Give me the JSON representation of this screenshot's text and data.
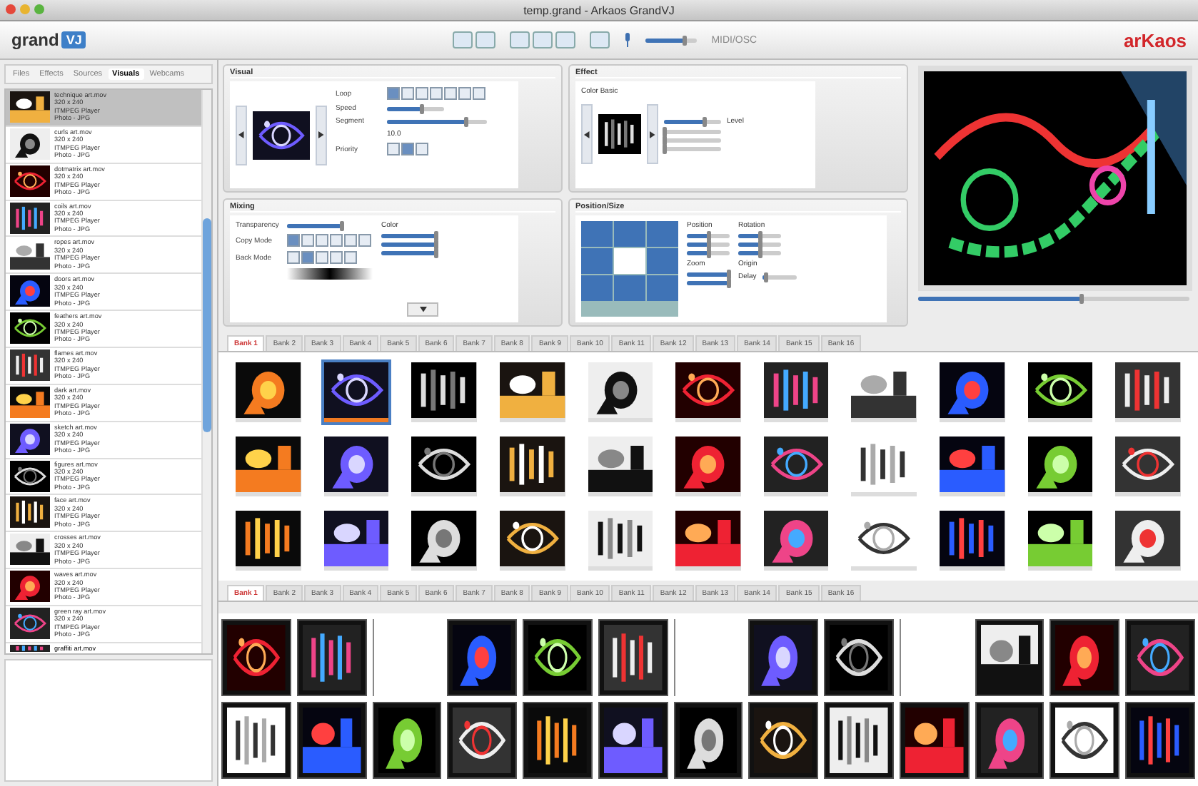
{
  "window": {
    "title": "temp.grand - Arkaos GrandVJ"
  },
  "toolbar": {
    "logo": "grand",
    "logo_badge": "VJ",
    "midi": "MIDI/OSC",
    "brand": "arKaos",
    "volume": {
      "level": 0.75
    }
  },
  "sidebar": {
    "tabs": [
      {
        "label": "Files",
        "selected": false
      },
      {
        "label": "Effects",
        "selected": false
      },
      {
        "label": "Sources",
        "selected": false
      },
      {
        "label": "Visuals",
        "selected": true
      },
      {
        "label": "Webcams",
        "selected": false
      }
    ],
    "items": [
      {
        "name": "technique art.mov",
        "size": "320 x 240",
        "player": "ITMPEG Player",
        "type": "Photo - JPG",
        "selected": true
      },
      {
        "name": "curls art.mov",
        "size": "320 x 240",
        "player": "ITMPEG Player",
        "type": "Photo - JPG",
        "selected": false
      },
      {
        "name": "dotmatrix art.mov",
        "size": "320 x 240",
        "player": "ITMPEG Player",
        "type": "Photo - JPG",
        "selected": false
      },
      {
        "name": "coils art.mov",
        "size": "320 x 240",
        "player": "ITMPEG Player",
        "type": "Photo - JPG",
        "selected": false
      },
      {
        "name": "ropes art.mov",
        "size": "320 x 240",
        "player": "ITMPEG Player",
        "type": "Photo - JPG",
        "selected": false
      },
      {
        "name": "doors art.mov",
        "size": "320 x 240",
        "player": "ITMPEG Player",
        "type": "Photo - JPG",
        "selected": false
      },
      {
        "name": "feathers art.mov",
        "size": "320 x 240",
        "player": "ITMPEG Player",
        "type": "Photo - JPG",
        "selected": false
      },
      {
        "name": "flames art.mov",
        "size": "320 x 240",
        "player": "ITMPEG Player",
        "type": "Photo - JPG",
        "selected": false
      },
      {
        "name": "dark art.mov",
        "size": "320 x 240",
        "player": "ITMPEG Player",
        "type": "Photo - JPG",
        "selected": false
      },
      {
        "name": "sketch art.mov",
        "size": "320 x 240",
        "player": "ITMPEG Player",
        "type": "Photo - JPG",
        "selected": false
      },
      {
        "name": "figures art.mov",
        "size": "320 x 240",
        "player": "ITMPEG Player",
        "type": "Photo - JPG",
        "selected": false
      },
      {
        "name": "face art.mov",
        "size": "320 x 240",
        "player": "ITMPEG Player",
        "type": "Photo - JPG",
        "selected": false
      },
      {
        "name": "crosses art.mov",
        "size": "320 x 240",
        "player": "ITMPEG Player",
        "type": "Photo - JPG",
        "selected": false
      },
      {
        "name": "waves art.mov",
        "size": "320 x 240",
        "player": "ITMPEG Player",
        "type": "Photo - JPG",
        "selected": false
      },
      {
        "name": "green ray art.mov",
        "size": "320 x 240",
        "player": "ITMPEG Player",
        "type": "Photo - JPG",
        "selected": false
      }
    ],
    "last_item": "graffiti art.mov"
  },
  "visual": {
    "title": "Visual",
    "loop_label": "Loop",
    "loop_modes": [
      {
        "selected": true
      },
      {
        "selected": false
      },
      {
        "selected": false
      },
      {
        "selected": false
      },
      {
        "selected": false
      },
      {
        "selected": false
      },
      {
        "selected": false
      }
    ],
    "speed_label": "Speed",
    "speed": {
      "level": 0.6
    },
    "segment_label": "Segment",
    "segment": {
      "level": 0.78
    },
    "segment_value": "10.0",
    "priority_label": "Priority",
    "priorities": [
      {
        "selected": false
      },
      {
        "selected": true
      },
      {
        "selected": false
      }
    ]
  },
  "effect": {
    "title": "Effect",
    "name": "Color Basic",
    "sliders": [
      {
        "level": 0.7
      },
      {
        "level": 0
      },
      {
        "level": 0
      },
      {
        "level": 0
      }
    ],
    "value_label": "Level"
  },
  "mixing": {
    "title": "Mixing",
    "transparency_label": "Transparency",
    "transparency": {
      "level": 0.95
    },
    "copy_label": "Copy Mode",
    "copy_modes": [
      {
        "selected": true
      },
      {
        "selected": false
      },
      {
        "selected": false
      },
      {
        "selected": false
      },
      {
        "selected": false
      },
      {
        "selected": false
      }
    ],
    "back_label": "Back Mode",
    "back_modes": [
      {
        "selected": false
      },
      {
        "selected": true
      },
      {
        "selected": false
      },
      {
        "selected": false
      },
      {
        "selected": false
      }
    ],
    "color_label": "Color",
    "colors": [
      {
        "level": 0.95
      },
      {
        "level": 0.95
      },
      {
        "level": 0.95
      }
    ]
  },
  "position": {
    "title": "Position/Size",
    "position_label": "Position",
    "rotation_label": "Rotation",
    "zoom_label": "Zoom",
    "origin_label": "Origin",
    "delay_label": "Delay",
    "positions": [
      {
        "level": 0.5
      },
      {
        "level": 0.5
      },
      {
        "level": 0.5
      }
    ],
    "rotations": [
      {
        "level": 0.5
      },
      {
        "level": 0.5
      },
      {
        "level": 0.5
      }
    ],
    "zooms": [
      {
        "level": 0.95
      },
      {
        "level": 0.95
      }
    ],
    "delay": {
      "level": 0.1
    },
    "cells": [
      {
        "selected": false
      },
      {
        "selected": false
      },
      {
        "selected": false
      },
      {
        "selected": false
      },
      {
        "selected": true
      },
      {
        "selected": false
      },
      {
        "selected": false
      },
      {
        "selected": false
      },
      {
        "selected": false
      }
    ]
  },
  "preview": {
    "position": {
      "level": 0.6
    }
  },
  "banks_top": [
    {
      "label": "Bank 1",
      "selected": true
    },
    {
      "label": "Bank 2",
      "selected": false
    },
    {
      "label": "Bank 3",
      "selected": false
    },
    {
      "label": "Bank 4",
      "selected": false
    },
    {
      "label": "Bank 5",
      "selected": false
    },
    {
      "label": "Bank 6",
      "selected": false
    },
    {
      "label": "Bank 7",
      "selected": false
    },
    {
      "label": "Bank 8",
      "selected": false
    },
    {
      "label": "Bank 9",
      "selected": false
    },
    {
      "label": "Bank 10",
      "selected": false
    },
    {
      "label": "Bank 11",
      "selected": false
    },
    {
      "label": "Bank 12",
      "selected": false
    },
    {
      "label": "Bank 13",
      "selected": false
    },
    {
      "label": "Bank 14",
      "selected": false
    },
    {
      "label": "Bank 15",
      "selected": false
    },
    {
      "label": "Bank 16",
      "selected": false
    }
  ],
  "grid_top": [
    {
      "selected": false
    },
    {
      "selected": true
    },
    {
      "selected": false
    },
    {
      "selected": false
    },
    {
      "selected": false
    },
    {
      "selected": false
    },
    {
      "selected": false
    },
    {
      "selected": false
    },
    {
      "selected": false
    },
    {
      "selected": false
    },
    {
      "selected": false
    },
    {
      "selected": false
    },
    {
      "selected": false
    },
    {
      "selected": false
    },
    {
      "selected": false
    },
    {
      "selected": false
    },
    {
      "selected": false
    },
    {
      "selected": false
    },
    {
      "selected": false
    },
    {
      "selected": false
    },
    {
      "selected": false
    },
    {
      "selected": false
    },
    {
      "selected": false
    },
    {
      "selected": false
    },
    {
      "selected": false
    },
    {
      "selected": false
    },
    {
      "selected": false
    },
    {
      "selected": false
    },
    {
      "selected": false
    },
    {
      "selected": false
    },
    {
      "selected": false
    },
    {
      "selected": false
    },
    {
      "selected": false
    }
  ],
  "banks_bottom": [
    {
      "label": "Bank 1",
      "selected": true
    },
    {
      "label": "Bank 2",
      "selected": false
    },
    {
      "label": "Bank 3",
      "selected": false
    },
    {
      "label": "Bank 4",
      "selected": false
    },
    {
      "label": "Bank 5",
      "selected": false
    },
    {
      "label": "Bank 6",
      "selected": false
    },
    {
      "label": "Bank 7",
      "selected": false
    },
    {
      "label": "Bank 8",
      "selected": false
    },
    {
      "label": "Bank 9",
      "selected": false
    },
    {
      "label": "Bank 10",
      "selected": false
    },
    {
      "label": "Bank 11",
      "selected": false
    },
    {
      "label": "Bank 12",
      "selected": false
    },
    {
      "label": "Bank 13",
      "selected": false
    },
    {
      "label": "Bank 14",
      "selected": false
    },
    {
      "label": "Bank 15",
      "selected": false
    },
    {
      "label": "Bank 16",
      "selected": false
    }
  ],
  "grid_bottom": [
    {
      "kind": "picture"
    },
    {
      "kind": "picture"
    },
    {
      "kind": "empty"
    },
    {
      "kind": "picture"
    },
    {
      "kind": "picture"
    },
    {
      "kind": "picture"
    },
    {
      "kind": "empty"
    },
    {
      "kind": "picture"
    },
    {
      "kind": "picture"
    },
    {
      "kind": "empty"
    },
    {
      "kind": "picture"
    },
    {
      "kind": "picture"
    },
    {
      "kind": "picture"
    },
    {
      "kind": "picture"
    },
    {
      "kind": "picture"
    },
    {
      "kind": "picture"
    },
    {
      "kind": "picture"
    },
    {
      "kind": "picture"
    },
    {
      "kind": "picture"
    },
    {
      "kind": "picture"
    },
    {
      "kind": "picture"
    },
    {
      "kind": "picture"
    },
    {
      "kind": "picture"
    },
    {
      "kind": "picture"
    },
    {
      "kind": "picture"
    },
    {
      "kind": "picture"
    }
  ]
}
